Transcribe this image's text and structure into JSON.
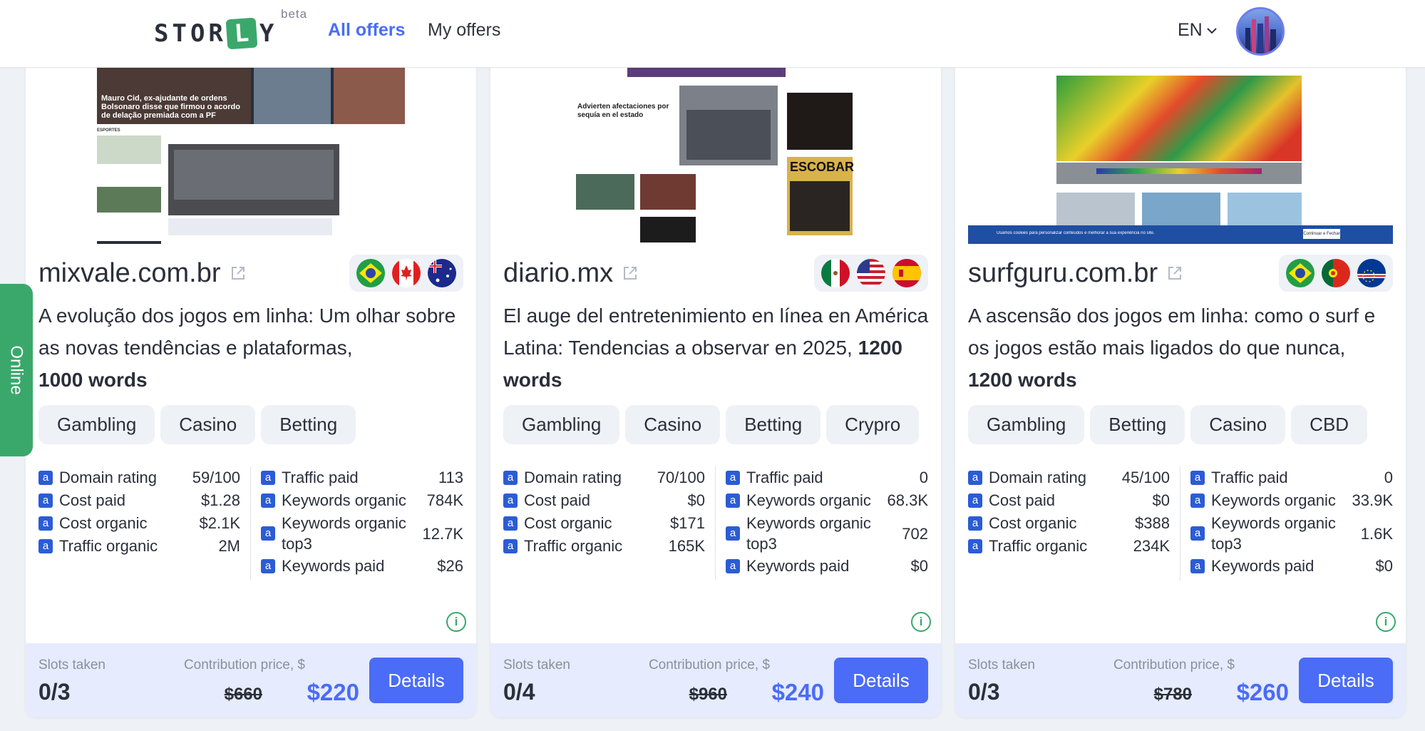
{
  "header": {
    "logo": "STORLY",
    "logo_pre": "STOR",
    "logo_box": "L",
    "logo_post": "Y",
    "beta": "beta",
    "nav": [
      {
        "label": "All offers",
        "active": true
      },
      {
        "label": "My offers",
        "active": false
      }
    ],
    "language": "EN"
  },
  "online_tab": "Online",
  "colors": {
    "accent": "#4a6cf7",
    "green": "#3aa86b",
    "metric_icon": "#2b5cd6"
  },
  "cards": [
    {
      "site": "mixvale.com.br",
      "flags": [
        "brazil-flag",
        "canada-flag",
        "australia-flag"
      ],
      "title": "A evolução dos jogos em linha: Um olhar sobre as novas tendências e plataformas,",
      "words": "1000 words",
      "tags": [
        "Gambling",
        "Casino",
        "Betting"
      ],
      "metrics_left": [
        {
          "label": "Domain rating",
          "value": "59/100"
        },
        {
          "label": "Cost paid",
          "value": "$1.28"
        },
        {
          "label": "Cost organic",
          "value": "$2.1K"
        },
        {
          "label": "Traffic organic",
          "value": "2M"
        }
      ],
      "metrics_right": [
        {
          "label": "Traffic paid",
          "value": "113"
        },
        {
          "label": "Keywords organic",
          "value": "784K"
        },
        {
          "label": "Keywords organic top3",
          "value": "12.7K"
        },
        {
          "label": "Keywords paid",
          "value": "$26"
        }
      ],
      "slots_label": "Slots taken",
      "slots": "0/3",
      "price_label": "Contribution price, $",
      "old_price": "$660",
      "new_price": "$220",
      "button": "Details",
      "shot": {
        "headline_1": "Mauro Cid, ex-ajudante de ordens Bolsonaro disse que firmou o acordo de delação premiada com a PF",
        "section": "ESPORTES"
      }
    },
    {
      "site": "diario.mx",
      "flags": [
        "mexico-flag",
        "usa-flag",
        "spain-flag"
      ],
      "title": "El auge del entretenimiento en línea en América Latina: Tendencias a observar en 2025,",
      "words": "1200 words",
      "tags": [
        "Gambling",
        "Casino",
        "Betting",
        "Crypro"
      ],
      "metrics_left": [
        {
          "label": "Domain rating",
          "value": "70/100"
        },
        {
          "label": "Cost paid",
          "value": "$0"
        },
        {
          "label": "Cost organic",
          "value": "$171"
        },
        {
          "label": "Traffic organic",
          "value": "165K"
        }
      ],
      "metrics_right": [
        {
          "label": "Traffic paid",
          "value": "0"
        },
        {
          "label": "Keywords organic",
          "value": "68.3K"
        },
        {
          "label": "Keywords organic top3",
          "value": "702"
        },
        {
          "label": "Keywords paid",
          "value": "$0"
        }
      ],
      "slots_label": "Slots taken",
      "slots": "0/4",
      "price_label": "Contribution price, $",
      "old_price": "$960",
      "new_price": "$240",
      "button": "Details",
      "shot": {
        "headline_1": "Advierten afectaciones por sequía en el estado",
        "promo": "ESCOBAR"
      }
    },
    {
      "site": "surfguru.com.br",
      "flags": [
        "brazil-flag",
        "portugal-flag",
        "cape-verde-flag"
      ],
      "title": "A ascensão dos jogos em linha: como o surf e os jogos estão mais ligados do que nunca,",
      "words": "1200 words",
      "tags": [
        "Gambling",
        "Betting",
        "Casino",
        "CBD"
      ],
      "metrics_left": [
        {
          "label": "Domain rating",
          "value": "45/100"
        },
        {
          "label": "Cost paid",
          "value": "$0"
        },
        {
          "label": "Cost organic",
          "value": "$388"
        },
        {
          "label": "Traffic organic",
          "value": "234K"
        }
      ],
      "metrics_right": [
        {
          "label": "Traffic paid",
          "value": "0"
        },
        {
          "label": "Keywords organic",
          "value": "33.9K"
        },
        {
          "label": "Keywords organic top3",
          "value": "1.6K"
        },
        {
          "label": "Keywords paid",
          "value": "$0"
        }
      ],
      "slots_label": "Slots taken",
      "slots": "0/3",
      "price_label": "Contribution price, $",
      "old_price": "$780",
      "new_price": "$260",
      "button": "Details",
      "shot": {
        "cookie_text": "Usamos cookies para personalizar conteúdos e melhorar a sua experiência no site.",
        "cookie_button": "Continuar e Fechar"
      }
    }
  ]
}
